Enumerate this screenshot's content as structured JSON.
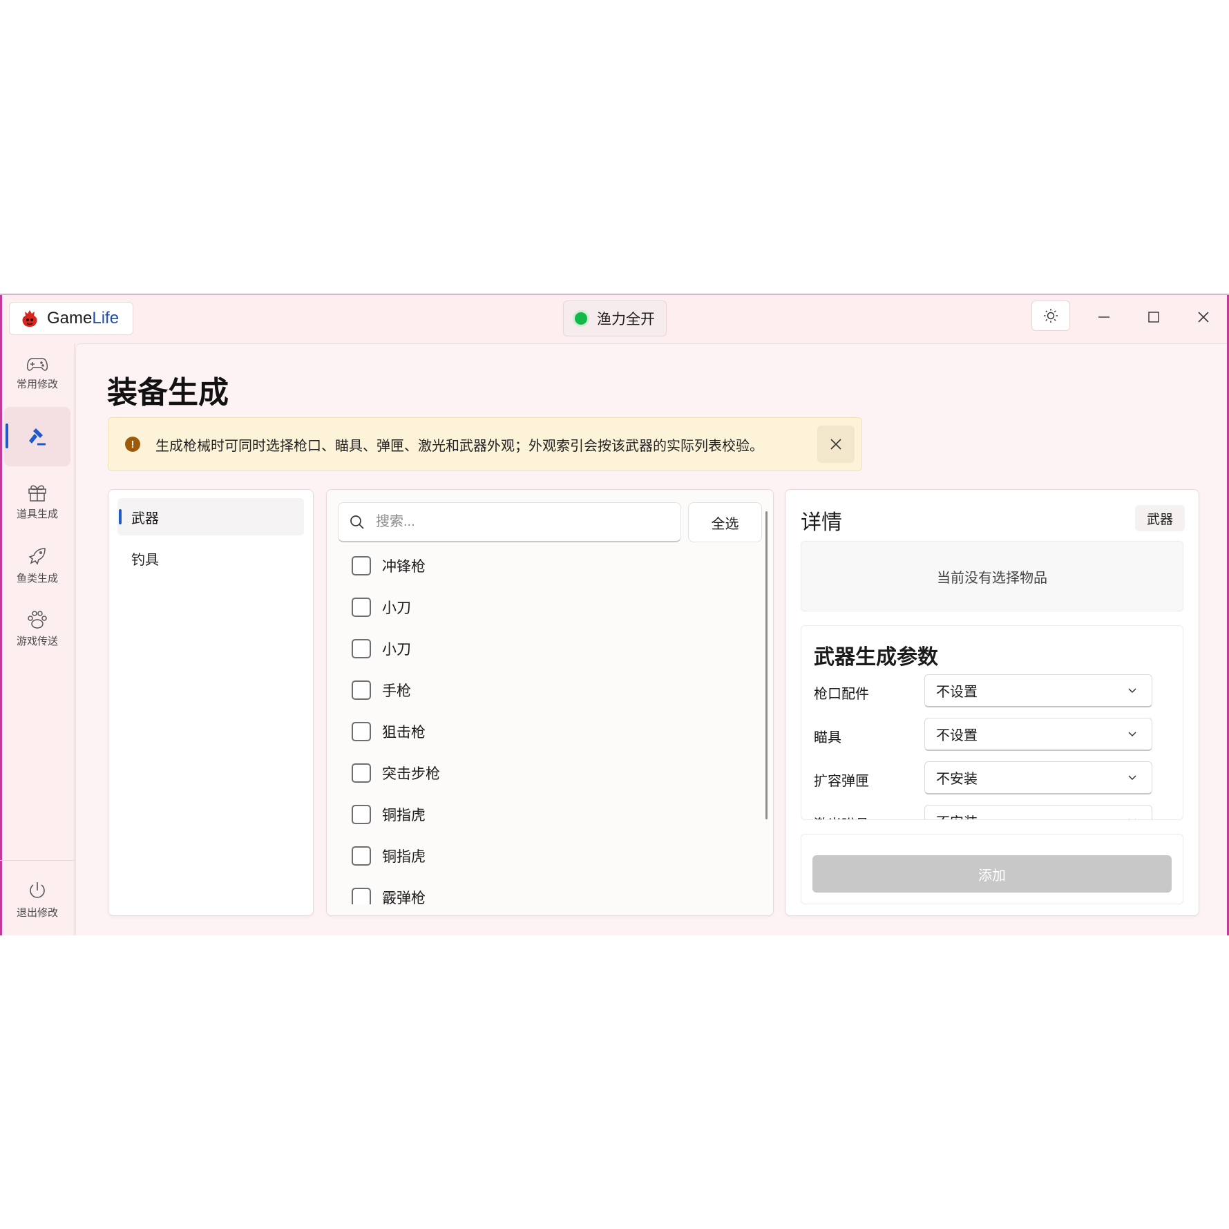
{
  "app": {
    "name_part1": "Game",
    "name_part2": "Life"
  },
  "status": {
    "label": "渔力全开",
    "color": "#14b84a"
  },
  "nav": {
    "items": [
      {
        "label": "常用修改",
        "icon": "gamepad-icon"
      },
      {
        "label": "",
        "icon": "hammer-icon",
        "active": true
      },
      {
        "label": "道具生成",
        "icon": "gift-icon"
      },
      {
        "label": "鱼类生成",
        "icon": "fish-icon"
      },
      {
        "label": "游戏传送",
        "icon": "paw-icon"
      }
    ],
    "exit_label": "退出修改"
  },
  "page": {
    "title": "装备生成",
    "alert": "生成枪械时可同时选择枪口、瞄具、弹匣、激光和武器外观；外观索引会按该武器的实际列表校验。"
  },
  "categories": [
    "武器",
    "钓具"
  ],
  "search": {
    "placeholder": "搜索...",
    "select_all": "全选"
  },
  "items": [
    "冲锋枪",
    "小刀",
    "小刀",
    "手枪",
    "狙击枪",
    "突击步枪",
    "铜指虎",
    "铜指虎",
    "霰弹枪"
  ],
  "detail": {
    "title": "详情",
    "tag": "武器",
    "empty": "当前没有选择物品",
    "params_title": "武器生成参数",
    "params": [
      {
        "label": "枪口配件",
        "value": "不设置"
      },
      {
        "label": "瞄具",
        "value": "不设置"
      },
      {
        "label": "扩容弹匣",
        "value": "不安装"
      },
      {
        "label": "激光瞄具",
        "value": "不安装"
      }
    ],
    "add_label": "添加"
  },
  "colors": {
    "accent": "#1e5bc6",
    "window_bg": "#fdeff0",
    "alert_bg": "#fdf3d8",
    "disabled_btn": "#c8c8c8"
  }
}
